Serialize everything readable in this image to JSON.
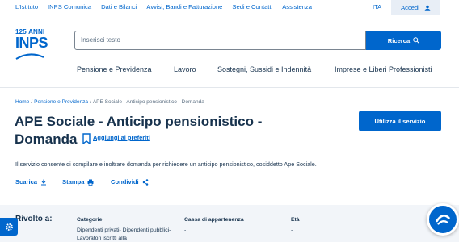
{
  "topbar": {
    "links": [
      "L'Istituto",
      "INPS Comunica",
      "Dati e Bilanci",
      "Avvisi, Bandi e Fatturazione",
      "Sedi e Contatti",
      "Assistenza"
    ],
    "language": "ITA",
    "login": "Accedi"
  },
  "logo": {
    "years": "125 ANNI",
    "name": "INPS"
  },
  "search": {
    "placeholder": "Inserisci testo",
    "button": "Ricerca"
  },
  "nav": [
    "Pensione e Previdenza",
    "Lavoro",
    "Sostegni, Sussidi e Indennità",
    "Imprese e Liberi Professionisti"
  ],
  "breadcrumb": {
    "home": "Home",
    "section": "Pensione e Previdenza",
    "current": "APE Sociale - Anticipo pensionistico - Domanda"
  },
  "page": {
    "title": "APE Sociale - Anticipo pensionistico - Domanda",
    "favorite": "Aggiungi ai preferiti",
    "use_service": "Utilizza il servizio",
    "description": "Il servizio consente di compilare e inoltrare domanda per richiedere un anticipo pensionistico, cosiddetto Ape Sociale."
  },
  "actions": {
    "download": "Scarica",
    "print": "Stampa",
    "share": "Condividi"
  },
  "target": {
    "heading": "Rivolto a:",
    "columns": [
      {
        "header": "Categorie",
        "value": "Dipendenti privati- Dipendenti pubblici- Lavoratori iscritti alla"
      },
      {
        "header": "Cassa di appartenenza",
        "value": "-"
      },
      {
        "header": "Età",
        "value": "-"
      }
    ]
  },
  "colors": {
    "primary": "#0066cc",
    "text": "#17324d",
    "panel": "#f2f5f9"
  },
  "icons": [
    "user-icon",
    "search-icon",
    "bookmark-icon",
    "download-icon",
    "print-icon",
    "share-icon",
    "gear-icon",
    "chatbot-icon"
  ]
}
